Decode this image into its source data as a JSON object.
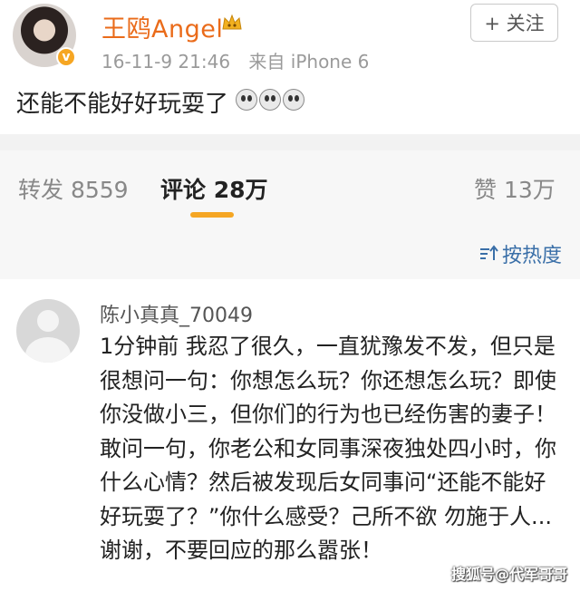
{
  "post": {
    "username": "王鸥Angel",
    "timestamp": "16-11-9 21:46",
    "source": "来自 iPhone 6",
    "follow_label": "+ 关注",
    "text": "还能不能好好玩耍了",
    "emoji_icons": [
      "cry-emoji",
      "cry-emoji",
      "cry-emoji"
    ]
  },
  "tabs": {
    "repost_label": "转发 8559",
    "comments_label": "评论 28万",
    "likes_label": "赞 13万",
    "active": "comments",
    "accent_color": "#f5a623"
  },
  "sort": {
    "label": "按热度"
  },
  "comment": {
    "username": "陈小真真_70049",
    "time": "1分钟前",
    "text": "我忍了很久，一直犹豫发不发，但只是很想问一句：你想怎么玩？你还想怎么玩？即使你没做小三，但你们的行为也已经伤害的妻子！敢问一句，你老公和女同事深夜独处四小时，你什么心情？然后被发现后女同事问“还能不能好好玩耍了？”你什么感受？己所不欲 勿施于人...谢谢，不要回应的那么嚣张！"
  },
  "watermark": "搜狐号@代军哥哥",
  "colors": {
    "username": "#ea6b1a",
    "link": "#3a6fa8",
    "verified_badge": "#f6a623"
  }
}
